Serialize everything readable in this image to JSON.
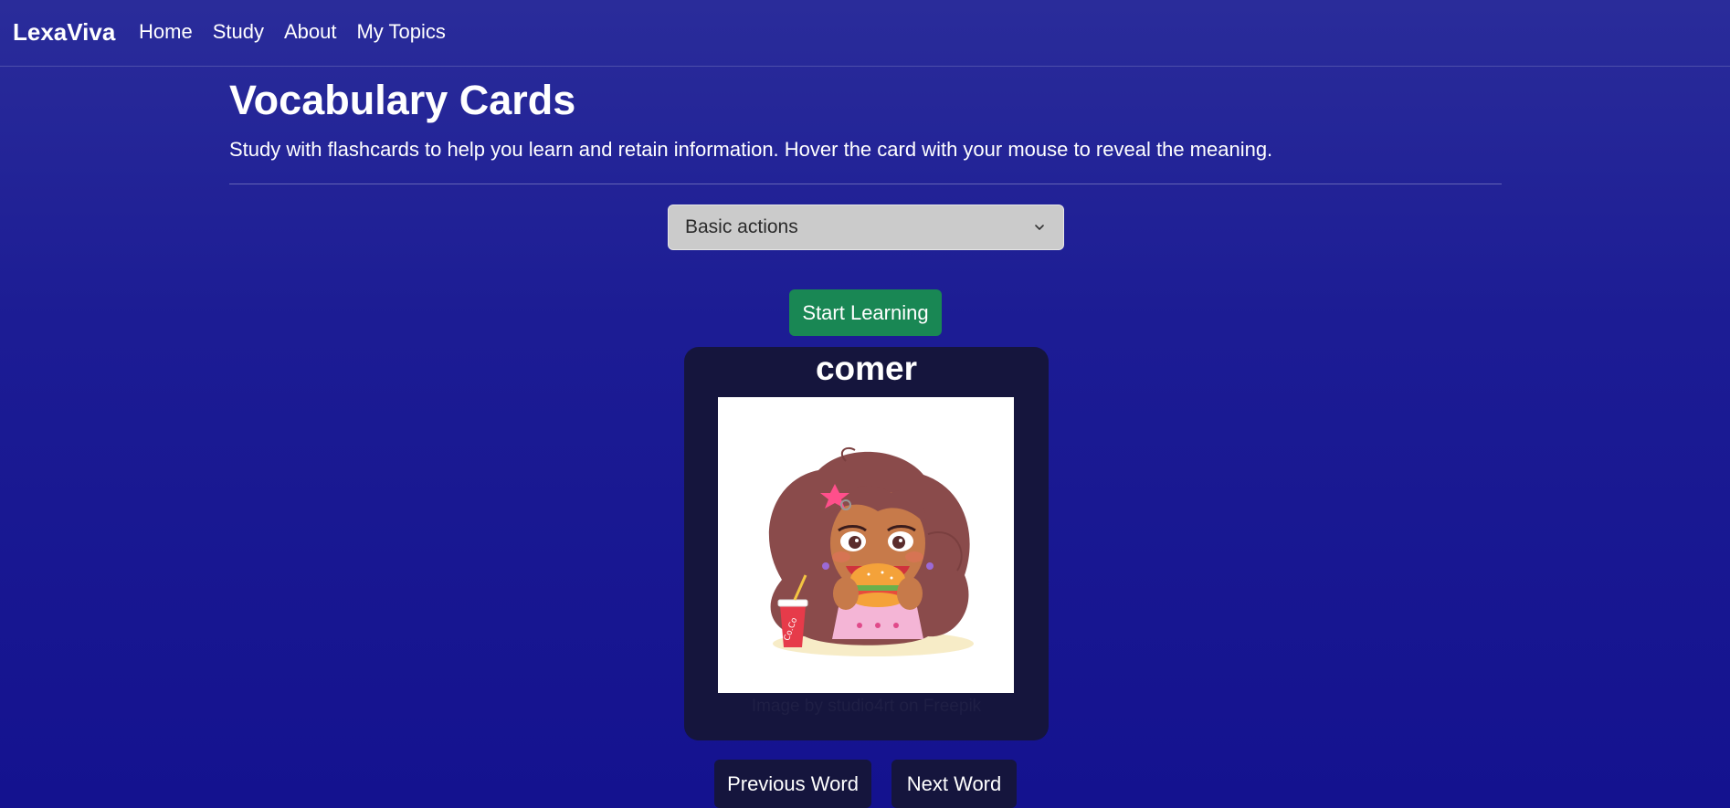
{
  "navbar": {
    "brand": "LexaViva",
    "links": [
      "Home",
      "Study",
      "About",
      "My Topics"
    ]
  },
  "page": {
    "title": "Vocabulary Cards",
    "description": "Study with flashcards to help you learn and retain information. Hover the card with your mouse to reveal the meaning."
  },
  "topic_select": {
    "selected": "Basic actions",
    "icon": "chevron-down-icon"
  },
  "start_button": {
    "label": "Start Learning"
  },
  "card": {
    "word": "comer",
    "image_alt": "girl eating a burger illustration",
    "credit": "Image by studio4rt on Freepik"
  },
  "controls": {
    "prev_label": "Previous Word",
    "next_label": "Next Word"
  },
  "colors": {
    "background_top": "#2a2c9a",
    "background_bottom": "#14128f",
    "start_button": "#198754",
    "card": "#15153d",
    "select": "#cbcbcb"
  }
}
